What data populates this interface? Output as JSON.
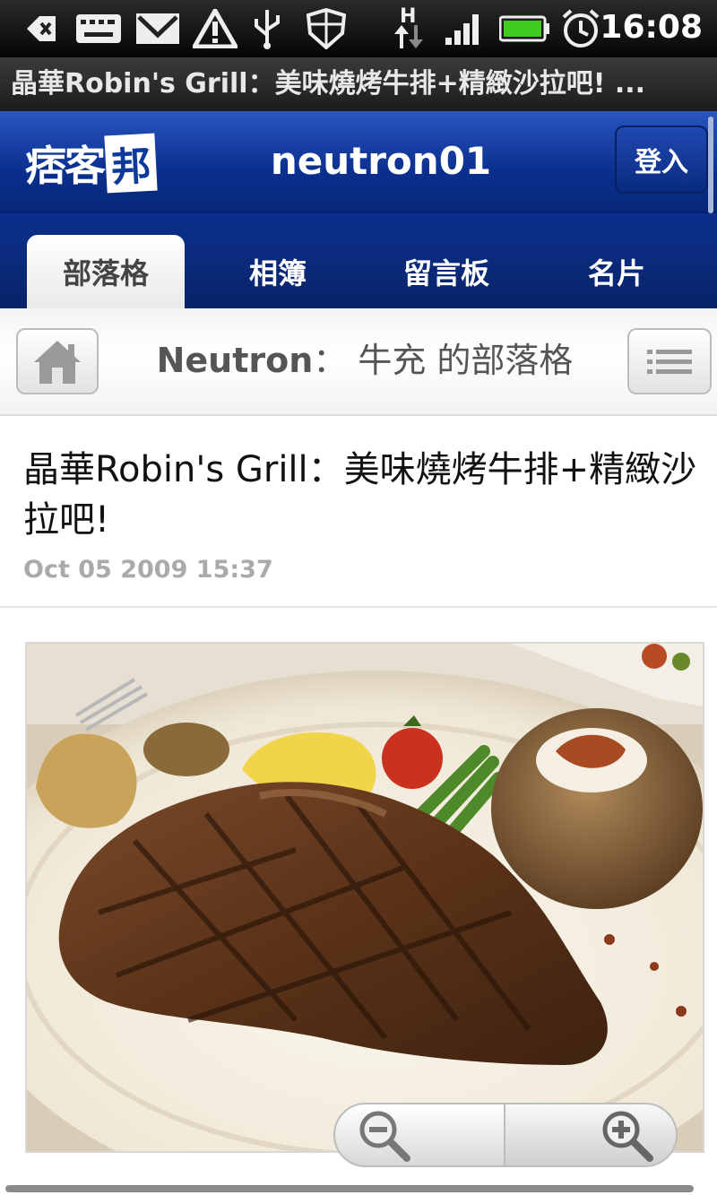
{
  "status_bar": {
    "time": "16:08",
    "network_label": "H",
    "icons": [
      "back-arrow-icon",
      "keyboard-icon",
      "gmail-icon",
      "warning-icon",
      "usb-icon",
      "shield-icon",
      "data-transfer-icon",
      "signal-icon",
      "battery-icon",
      "alarm-icon"
    ]
  },
  "browser": {
    "page_title": "晶華Robin's Grill：美味燒烤牛排+精緻沙拉吧! ..."
  },
  "header": {
    "logo_text": "痞客",
    "logo_box": "邦",
    "username": "neutron01",
    "login_label": "登入"
  },
  "tabs": [
    {
      "label": "部落格",
      "active": true
    },
    {
      "label": "相簿",
      "active": false
    },
    {
      "label": "留言板",
      "active": false
    },
    {
      "label": "名片",
      "active": false
    }
  ],
  "blog": {
    "name_bold": "Neutron",
    "name_rest": "： 牛充 的部落格"
  },
  "post": {
    "title": "晶華Robin's Grill：美味燒烤牛排+精緻沙拉吧!",
    "date": "Oct 05 2009 15:37",
    "image_icon": "steak-photo"
  },
  "colors": {
    "header_blue": "#0a2f8e",
    "date_gray": "#aaaaaa"
  }
}
